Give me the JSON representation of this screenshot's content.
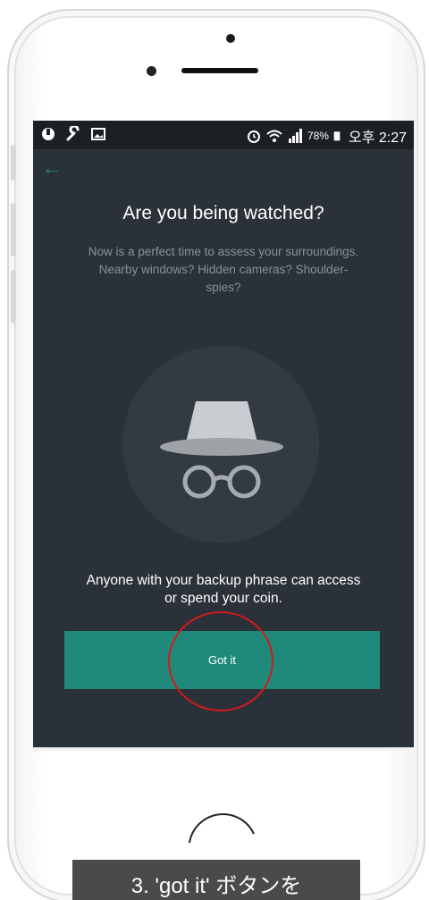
{
  "status_bar": {
    "left_icons": [
      "app-icon",
      "wrench-icon",
      "image-icon"
    ],
    "right_icons": [
      "alarm-icon",
      "wifi-icon",
      "signal-icon",
      "battery-icon"
    ],
    "battery": "78%",
    "time": "오후 2:27"
  },
  "screen": {
    "back_icon": "back-arrow-icon",
    "title": "Are you being watched?",
    "description": "Now is a perfect time to assess your surroundings. Nearby windows? Hidden cameras? Shoulder-spies?",
    "illustration_icon": "incognito-icon",
    "warning": "Anyone with your backup phrase can access or spend your coin.",
    "button_label": "Got it"
  },
  "nav_bar": {
    "icons": [
      "recent-apps-icon",
      "home-icon",
      "back-icon"
    ]
  },
  "caption": "3. 'got it' ボタンを",
  "colors": {
    "screen_bg": "#2b3138",
    "accent": "#1f8a7c",
    "highlight": "#d21a1a"
  }
}
